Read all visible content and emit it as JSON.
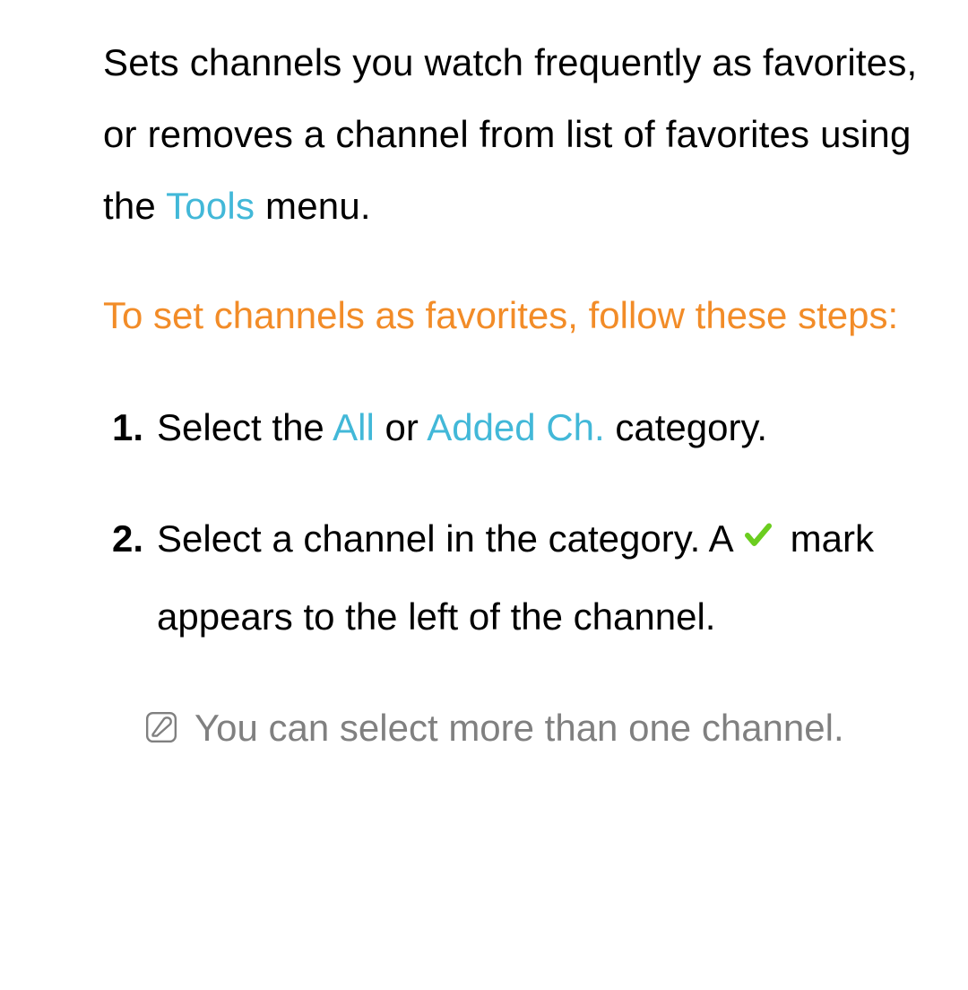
{
  "intro": {
    "part1": "Sets channels you watch frequently as favorites, or removes a channel from list of favorites using the ",
    "tools": "Tools",
    "part2": " menu."
  },
  "heading": "To set channels as favorites, follow these steps:",
  "steps": [
    {
      "num": "1.",
      "parts": {
        "a": "Select the ",
        "all": "All",
        "b": " or ",
        "added": "Added Ch.",
        "c": " category."
      }
    },
    {
      "num": "2.",
      "parts": {
        "a": "Select a channel in the category. A ",
        "b": " mark appears to the left of the channel."
      }
    }
  ],
  "note": "You can select more than one channel."
}
